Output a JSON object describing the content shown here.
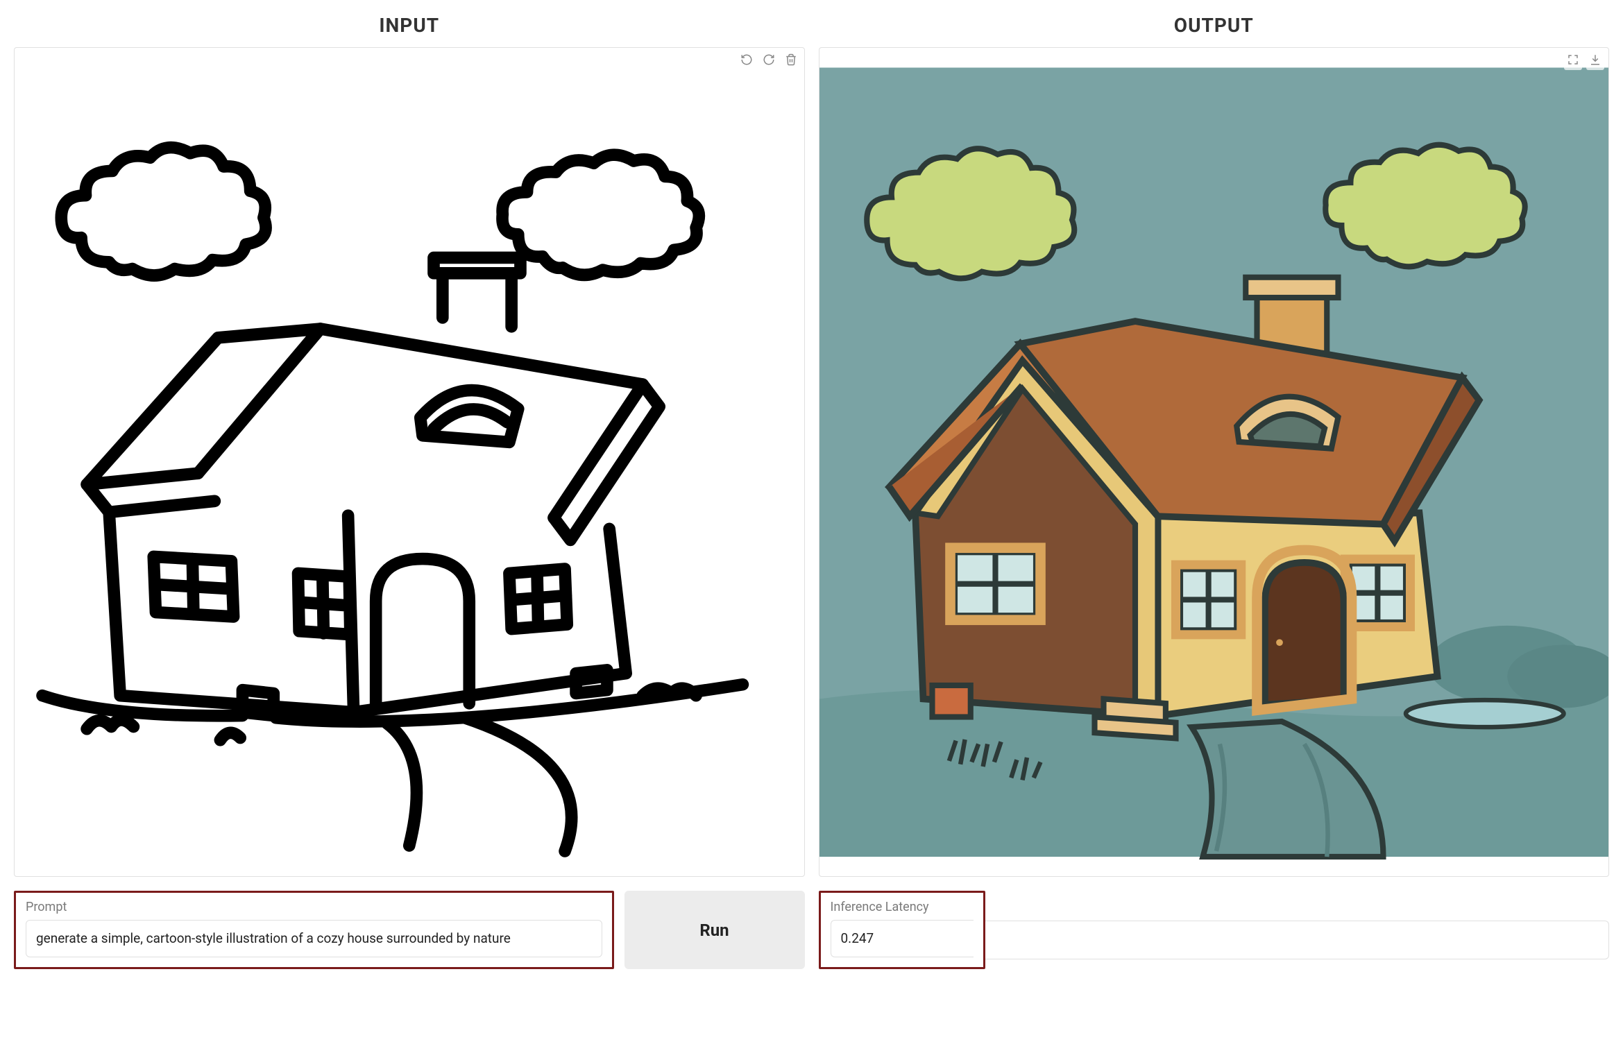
{
  "input": {
    "title": "INPUT",
    "toolbar": {
      "undo": "undo",
      "redo": "redo",
      "delete": "delete"
    },
    "prompt_label": "Prompt",
    "prompt_value": "generate a simple, cartoon-style illustration of a cozy house surrounded by nature",
    "run_label": "Run",
    "sketch_description": "black-and-white line sketch of a cartoon house with chimney, two clouds, windows, door, and a winding path"
  },
  "output": {
    "title": "OUTPUT",
    "toolbar": {
      "fullscreen": "fullscreen",
      "download": "download"
    },
    "latency_label": "Inference Latency",
    "latency_value": "0.247",
    "image_description": "colored cartoon illustration of a cozy house with brown roof, yellow walls, chimney, yellow-green clouds on teal sky, grass and a winding path"
  },
  "highlight_color": "#7a1b1b"
}
